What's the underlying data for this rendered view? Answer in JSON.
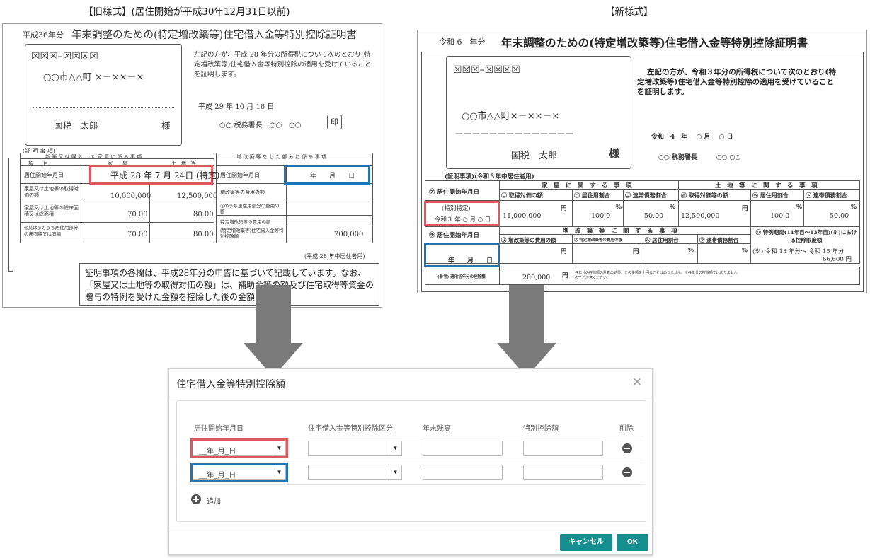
{
  "captions": {
    "old": "【旧様式】(居住開始が平成30年12月31日以前)",
    "new": "【新様式】"
  },
  "old_form": {
    "year_prefix": "平成36年分",
    "title": "年末調整のための(特定増改築等)住宅借入金等特別控除証明書",
    "postal": "☒☒☒–☒☒☒☒",
    "address": "○○市△△町 ×－××－×",
    "name": "国税　太郎",
    "sama": "様",
    "notice": "左記の方が、平成 28 年分の所得税について次のとおり(特定増改築等)住宅借入金等特別控除の適用を受けていることを証明します。",
    "date": "平成 29 年 10 月 16 日",
    "official": "○○ 税務署長　○○　○○",
    "seal": "印",
    "section": "(証 明 事 項)",
    "head_left": "新 築 又 は 購 入 し た 家 屋 に 係 る 事 項",
    "head_right": "増 改 築 等 を し た 部 分 に 係 る 事 項",
    "sub_item": "項　　目",
    "sub_house": "家　　屋",
    "sub_land": "土　地　等",
    "row1_label": "居住開始年月日",
    "row1_value": "平成 28 年 7 月 24日 (特定)",
    "row2_label": "家屋又は土地等の取得対価の額",
    "row2_house": "10,000,000",
    "row2_land": "12,500,000",
    "row3_label": "家屋又は土地等の総床面積又は総面積",
    "row3_house": "70.00",
    "row3_land": "80.00",
    "row4_label": "◎又は◎のうち居住用部分の床面積又は面積",
    "row4_house": "70.00",
    "row4_land": "80.00",
    "r_row1_label": "居住開始年月日",
    "r_row1_value": "年　　月　　日",
    "r_row2_label": "増改築等の費用の額",
    "r_row3_label": "◎のうち居住用部分の費用の額",
    "r_row4_label": "特定増改築等の費用の額",
    "r_row5_label": "(特定増改築等)住宅借入金等特別控除額",
    "r_row5_value": "200,000",
    "yen": "円",
    "sqm": "㎡",
    "residence_note": "(平成 28 年中居住者用)",
    "footnote": "証明事項の各欄は、平成28年分の申告に基づいて記載しています。なお、「家屋又は土地等の取得対価の額」は、補助金等の額及び住宅取得等資金の贈与の特例を受けた金額を控除した後の金額です。"
  },
  "new_form": {
    "year_prefix": "令和 6　年分",
    "title": "年末調整のための(特定増改築等)住宅借入金等特別控除証明書",
    "postal": "☒☒☒–☒☒☒☒",
    "address": "○○市△△町×－××－×",
    "dash": "－－－－－－－－－－－－－－",
    "name": "国税　太郎",
    "sama": "様",
    "notice": "左記の方が、令和３年分の所得税について次のとおり(特定増改築等)住宅借入金等特別控除の適用を受けていることを証明します。",
    "date": "令和　4　年　 ○ 月　 ○ 日",
    "official": "○○ 税務署長　　　○○ ○○",
    "section": "(証明事項)(令和３年中居住者用)",
    "a_label": "㋐ 居住開始年月日",
    "a_value_note": "(特別特定)",
    "a_value": "令和３ 年 ○ 月 ○ 日",
    "house_head": "家　屋　に　関　す　る　事　項",
    "land_head": "土　地　等　に　関　す　る　事　項",
    "h_cols": [
      "㋺ 取得対価の額",
      "㋩ 居住用割合",
      "㊁ 連帯債務割合"
    ],
    "l_cols": [
      "㋭ 取得対価等の額",
      "㋬ 居住用割合",
      "㋣ 連帯債務割合"
    ],
    "h_vals": [
      "11,000,000",
      "100.0",
      "50.00"
    ],
    "l_vals": [
      "12,500,000",
      "100.0",
      "50.00"
    ],
    "b_label": "㋠ 居住開始年月日",
    "b_value": "年　　月　　日",
    "reno_head": "増　改　築　等　に　関　す　る　事　項",
    "r_cols": [
      "㋷ 増改築等の費用の額",
      "㋦ 特定増改築等の費用の額",
      "㋸ 居住用割合",
      "㋾ 連帯債務割合"
    ],
    "special_head": "㋻ 特例期間(11年目～13年目)(※)における控除限度額",
    "special_value": "(※) 令和 13 年分～ 令和 15 年分",
    "special_amount": "66,600 円",
    "ref_label": "(参考) 適用初年分の控除額",
    "ref_value": "200,000",
    "ref_note": "各年分の控除額の計算の結果、この金額を上回ることはありません。※各年分の控除額ではありませんのでご注意ください。",
    "yen": "円",
    "pct": "%"
  },
  "dialog": {
    "title": "住宅借入金等特別控除額",
    "columns": {
      "start_date": "居住開始年月日",
      "category": "住宅借入金等特別控除区分",
      "balance": "年末残高",
      "deduction": "特別控除額",
      "delete": "削除"
    },
    "rows": [
      {
        "start_date": "__年_月_日",
        "category": "",
        "balance": "",
        "deduction": ""
      },
      {
        "start_date": "__年_月_日",
        "category": "",
        "balance": "",
        "deduction": ""
      }
    ],
    "add_label": "追加",
    "cancel_label": "キャンセル",
    "ok_label": "OK"
  },
  "colors": {
    "highlight_red": "#e0565b",
    "highlight_blue": "#1f73b7",
    "button": "#178f90",
    "arrow": "#7b7b7b"
  }
}
